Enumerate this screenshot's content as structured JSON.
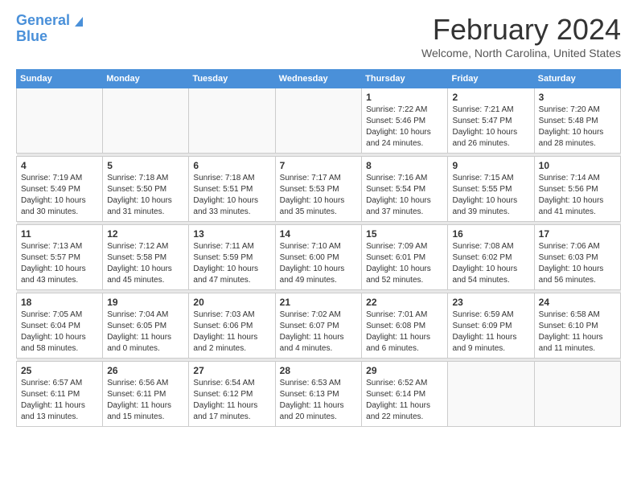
{
  "logo": {
    "line1": "General",
    "line2": "Blue"
  },
  "title": "February 2024",
  "location": "Welcome, North Carolina, United States",
  "days_of_week": [
    "Sunday",
    "Monday",
    "Tuesday",
    "Wednesday",
    "Thursday",
    "Friday",
    "Saturday"
  ],
  "weeks": [
    [
      {
        "day": "",
        "info": ""
      },
      {
        "day": "",
        "info": ""
      },
      {
        "day": "",
        "info": ""
      },
      {
        "day": "",
        "info": ""
      },
      {
        "day": "1",
        "info": "Sunrise: 7:22 AM\nSunset: 5:46 PM\nDaylight: 10 hours\nand 24 minutes."
      },
      {
        "day": "2",
        "info": "Sunrise: 7:21 AM\nSunset: 5:47 PM\nDaylight: 10 hours\nand 26 minutes."
      },
      {
        "day": "3",
        "info": "Sunrise: 7:20 AM\nSunset: 5:48 PM\nDaylight: 10 hours\nand 28 minutes."
      }
    ],
    [
      {
        "day": "4",
        "info": "Sunrise: 7:19 AM\nSunset: 5:49 PM\nDaylight: 10 hours\nand 30 minutes."
      },
      {
        "day": "5",
        "info": "Sunrise: 7:18 AM\nSunset: 5:50 PM\nDaylight: 10 hours\nand 31 minutes."
      },
      {
        "day": "6",
        "info": "Sunrise: 7:18 AM\nSunset: 5:51 PM\nDaylight: 10 hours\nand 33 minutes."
      },
      {
        "day": "7",
        "info": "Sunrise: 7:17 AM\nSunset: 5:53 PM\nDaylight: 10 hours\nand 35 minutes."
      },
      {
        "day": "8",
        "info": "Sunrise: 7:16 AM\nSunset: 5:54 PM\nDaylight: 10 hours\nand 37 minutes."
      },
      {
        "day": "9",
        "info": "Sunrise: 7:15 AM\nSunset: 5:55 PM\nDaylight: 10 hours\nand 39 minutes."
      },
      {
        "day": "10",
        "info": "Sunrise: 7:14 AM\nSunset: 5:56 PM\nDaylight: 10 hours\nand 41 minutes."
      }
    ],
    [
      {
        "day": "11",
        "info": "Sunrise: 7:13 AM\nSunset: 5:57 PM\nDaylight: 10 hours\nand 43 minutes."
      },
      {
        "day": "12",
        "info": "Sunrise: 7:12 AM\nSunset: 5:58 PM\nDaylight: 10 hours\nand 45 minutes."
      },
      {
        "day": "13",
        "info": "Sunrise: 7:11 AM\nSunset: 5:59 PM\nDaylight: 10 hours\nand 47 minutes."
      },
      {
        "day": "14",
        "info": "Sunrise: 7:10 AM\nSunset: 6:00 PM\nDaylight: 10 hours\nand 49 minutes."
      },
      {
        "day": "15",
        "info": "Sunrise: 7:09 AM\nSunset: 6:01 PM\nDaylight: 10 hours\nand 52 minutes."
      },
      {
        "day": "16",
        "info": "Sunrise: 7:08 AM\nSunset: 6:02 PM\nDaylight: 10 hours\nand 54 minutes."
      },
      {
        "day": "17",
        "info": "Sunrise: 7:06 AM\nSunset: 6:03 PM\nDaylight: 10 hours\nand 56 minutes."
      }
    ],
    [
      {
        "day": "18",
        "info": "Sunrise: 7:05 AM\nSunset: 6:04 PM\nDaylight: 10 hours\nand 58 minutes."
      },
      {
        "day": "19",
        "info": "Sunrise: 7:04 AM\nSunset: 6:05 PM\nDaylight: 11 hours\nand 0 minutes."
      },
      {
        "day": "20",
        "info": "Sunrise: 7:03 AM\nSunset: 6:06 PM\nDaylight: 11 hours\nand 2 minutes."
      },
      {
        "day": "21",
        "info": "Sunrise: 7:02 AM\nSunset: 6:07 PM\nDaylight: 11 hours\nand 4 minutes."
      },
      {
        "day": "22",
        "info": "Sunrise: 7:01 AM\nSunset: 6:08 PM\nDaylight: 11 hours\nand 6 minutes."
      },
      {
        "day": "23",
        "info": "Sunrise: 6:59 AM\nSunset: 6:09 PM\nDaylight: 11 hours\nand 9 minutes."
      },
      {
        "day": "24",
        "info": "Sunrise: 6:58 AM\nSunset: 6:10 PM\nDaylight: 11 hours\nand 11 minutes."
      }
    ],
    [
      {
        "day": "25",
        "info": "Sunrise: 6:57 AM\nSunset: 6:11 PM\nDaylight: 11 hours\nand 13 minutes."
      },
      {
        "day": "26",
        "info": "Sunrise: 6:56 AM\nSunset: 6:11 PM\nDaylight: 11 hours\nand 15 minutes."
      },
      {
        "day": "27",
        "info": "Sunrise: 6:54 AM\nSunset: 6:12 PM\nDaylight: 11 hours\nand 17 minutes."
      },
      {
        "day": "28",
        "info": "Sunrise: 6:53 AM\nSunset: 6:13 PM\nDaylight: 11 hours\nand 20 minutes."
      },
      {
        "day": "29",
        "info": "Sunrise: 6:52 AM\nSunset: 6:14 PM\nDaylight: 11 hours\nand 22 minutes."
      },
      {
        "day": "",
        "info": ""
      },
      {
        "day": "",
        "info": ""
      }
    ]
  ]
}
